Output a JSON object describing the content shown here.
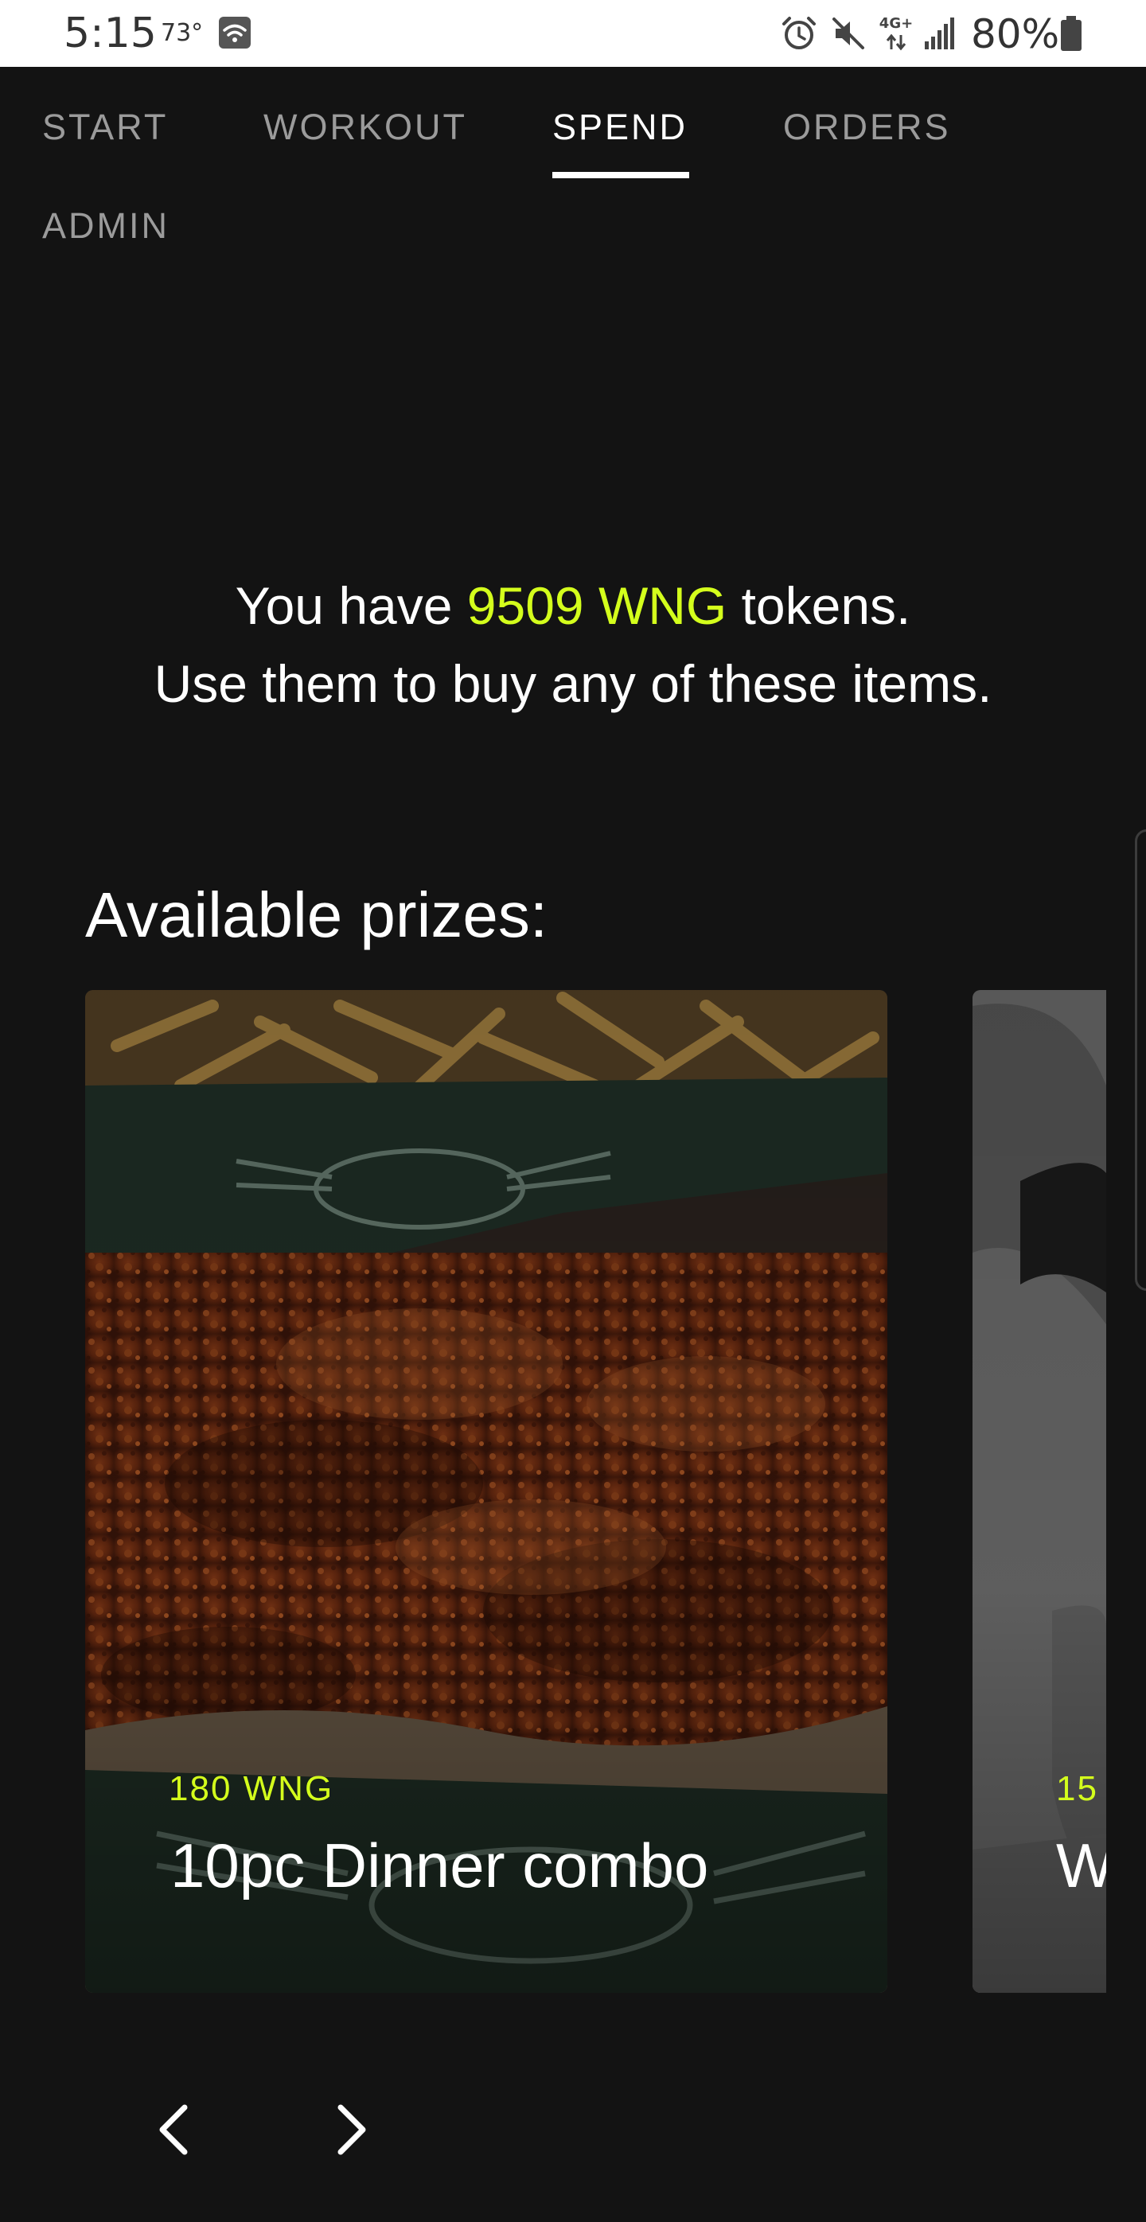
{
  "status_bar": {
    "time": "5:15",
    "temperature": "73°",
    "network_type": "4G+",
    "battery": "80%"
  },
  "tabs": [
    {
      "label": "START",
      "active": false
    },
    {
      "label": "WORKOUT",
      "active": false
    },
    {
      "label": "SPEND",
      "active": true
    },
    {
      "label": "ORDERS",
      "active": false
    },
    {
      "label": "ADMIN",
      "active": false
    }
  ],
  "message": {
    "prefix": "You have ",
    "token_amount": "9509 WNG",
    "suffix": " tokens.",
    "line2": "Use them to buy any of these items."
  },
  "prizes": {
    "title": "Available prizes:",
    "items": [
      {
        "price": "180 WNG",
        "name": "10pc Dinner combo"
      },
      {
        "price": "15",
        "name": "W"
      }
    ]
  },
  "nav_icons": {
    "prev": "chevron-left-icon",
    "next": "chevron-right-icon"
  },
  "colors": {
    "background": "#131313",
    "accent": "#d4ff1c",
    "tab_inactive": "#9b9b9b",
    "tab_active": "#ffffff"
  }
}
